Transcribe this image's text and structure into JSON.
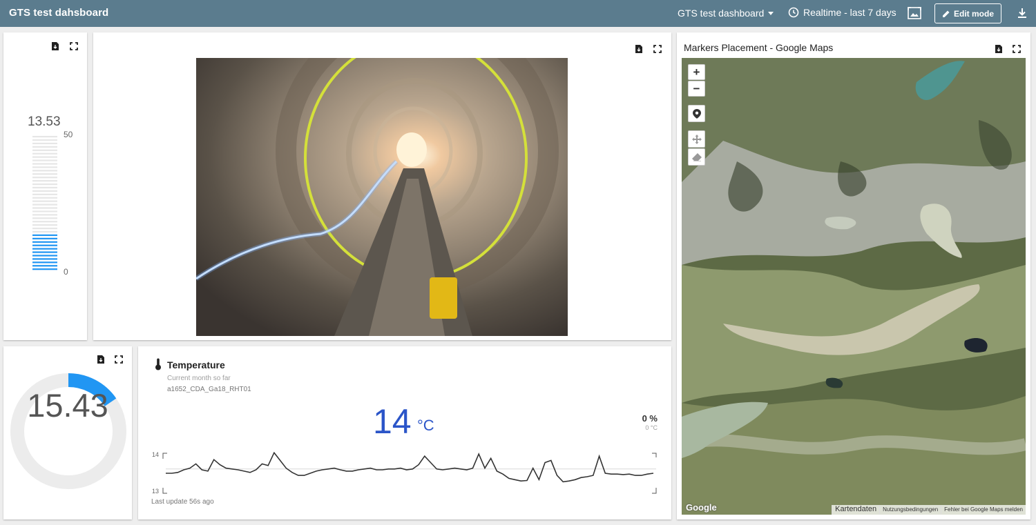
{
  "topbar": {
    "title": "GTS test dahsboard",
    "dashboard_select": "GTS test dashboard",
    "time_window": "Realtime - last 7 days",
    "edit_mode": "Edit mode"
  },
  "linear_gauge": {
    "value": "13.53",
    "max_label": "50",
    "min_label": "0",
    "value_num": 13.53,
    "max": 50,
    "min": 0,
    "fill_color": "#2196f3"
  },
  "map_card": {
    "title": "Markers Placement - Google Maps",
    "zoom_in": "+",
    "zoom_out": "−",
    "google_logo": "Google",
    "footer": [
      "Kartendaten",
      "Nutzungsbedingungen",
      "Fehler bei Google Maps melden"
    ]
  },
  "donut": {
    "value": "15.43",
    "value_num": 15.43,
    "max": 100,
    "color": "#2196f3"
  },
  "temperature": {
    "title": "Temperature",
    "subtitle": "Current month so far",
    "device": "a1652_CDA_Ga18_RHT01",
    "value": "14",
    "unit": "°C",
    "delta_pct": "0 %",
    "delta_unit": "0 °C",
    "y_max": "14",
    "y_min": "13",
    "last_update": "Last update 56s ago",
    "sparkline": [
      13.5,
      13.5,
      13.52,
      13.58,
      13.62,
      13.72,
      13.58,
      13.55,
      13.82,
      13.7,
      13.62,
      13.6,
      13.58,
      13.55,
      13.52,
      13.58,
      13.72,
      13.68,
      13.98,
      13.8,
      13.62,
      13.52,
      13.45,
      13.45,
      13.5,
      13.55,
      13.58,
      13.6,
      13.62,
      13.58,
      13.55,
      13.55,
      13.58,
      13.6,
      13.62,
      13.58,
      13.58,
      13.6,
      13.6,
      13.62,
      13.58,
      13.6,
      13.7,
      13.9,
      13.75,
      13.6,
      13.58,
      13.6,
      13.62,
      13.6,
      13.58,
      13.62,
      13.95,
      13.62,
      13.85,
      13.55,
      13.48,
      13.38,
      13.35,
      13.32,
      13.33,
      13.62,
      13.35,
      13.75,
      13.8,
      13.45,
      13.3,
      13.32,
      13.35,
      13.4,
      13.42,
      13.45,
      13.9,
      13.5,
      13.48,
      13.48,
      13.47,
      13.48,
      13.45,
      13.45,
      13.48,
      13.5
    ]
  }
}
